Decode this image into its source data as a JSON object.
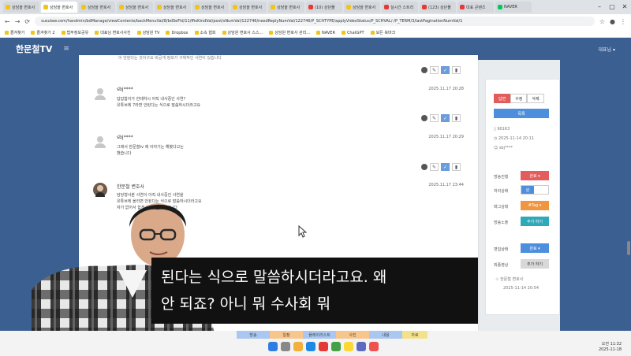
{
  "browser": {
    "tabs": [
      {
        "label": "상담을 변호사",
        "favicon": "y",
        "active": false
      },
      {
        "label": "상담을 변호사",
        "favicon": "y",
        "active": true
      },
      {
        "label": "상담을 변호사",
        "favicon": "y",
        "active": false
      },
      {
        "label": "상담을 변호사",
        "favicon": "y",
        "active": false
      },
      {
        "label": "상담을 변호사",
        "favicon": "y",
        "active": false
      },
      {
        "label": "상담을 변호사",
        "favicon": "y",
        "active": false
      },
      {
        "label": "상담을 변호사",
        "favicon": "y",
        "active": false
      },
      {
        "label": "상담을 변호사",
        "favicon": "y",
        "active": false
      },
      {
        "label": "(10) 상단물",
        "favicon": "r",
        "active": false
      },
      {
        "label": "상담을 변호사",
        "favicon": "y",
        "active": false
      },
      {
        "label": "실시간 스트리",
        "favicon": "r",
        "active": false
      },
      {
        "label": "(123) 상단물",
        "favicon": "r",
        "active": false
      },
      {
        "label": "대표 큰렌츠",
        "favicon": "r",
        "active": false
      },
      {
        "label": "NAVER",
        "favicon": "g",
        "active": false
      }
    ],
    "url": "susulaw.com/handmin/bdManage/viewContents/backMenuVal/8/bdSeFld/11/ffixKindVal/post/sNumVal/122746/needReplyNumVal/122746/P_SCHTYPE/applyVideoStatus/P_SCHVAL/-/P_TERM/3/lastPaginationNumVal/1",
    "bookmarks": [
      "즐겨찾기",
      "즐겨찾기 2",
      "법무정보공유",
      "대표님 변호사사진",
      "상담원 TV",
      "Dropbox",
      "소속 협회",
      "상담원 변호사 스스...",
      "상담원 변호사 관리...",
      "NAVER",
      "ChatGPT",
      "모든 북마크"
    ]
  },
  "app": {
    "logo": "한문철TV",
    "menu_icon": "≡",
    "user": "대표님 ▾"
  },
  "top_note": "이 안된다는 것이구요 비공개 정보가 구체적인 사연이 있습니다",
  "comments": [
    {
      "name": "sbj****",
      "date": "2025.11.17 20:28",
      "body": [
        "답답함이가 한테하시 아직 내사중인 사연?",
        "유튜브에 7라면 안된다는 식으로 말씀하시더라고요"
      ]
    },
    {
      "name": "sbj****",
      "date": "2025.11.17 20:29",
      "body": [
        "그래서 한문철tv 에 이야기는 해봤다고는",
        "했습니다"
      ]
    },
    {
      "name": "한문철 변호사",
      "date": "2025.11.17 23:44",
      "body": [
        "담당형사분 사연이 아직 내사중인 사연을",
        "유튜브에 올리면 안된다는 식으로 말씀하시더라고요",
        "",
        "",
        "",
        "자가 없어서 쉽게 해서 해야 한답니다"
      ]
    }
  ],
  "sidebar": {
    "buttons": [
      "답변",
      "수정",
      "삭제"
    ],
    "wide_button": "목록",
    "post_no": "90163",
    "post_date": "2025-11-14 20:11",
    "author": "sbj****",
    "rows": [
      {
        "label": "방송진행",
        "value": "완료 ▾",
        "style": "red"
      },
      {
        "label": "처리상태",
        "value": "완",
        "style": "toggle"
      },
      {
        "label": "태그상태",
        "value": "#Tag ▾",
        "style": "orange"
      },
      {
        "label": "방송노출",
        "value": "추가 하기",
        "style": "teal"
      },
      {
        "label": "편집상태",
        "value": "완료 ▾",
        "style": "blue"
      },
      {
        "label": "최종영상",
        "value": "추가 하기",
        "style": "gray"
      }
    ],
    "editor": "한문철 변호사",
    "editor_date": "2025-11-14 20:54"
  },
  "caption": [
    "된다는 식으로 말씀하시더라고요. 왜",
    "안 되죠? 아니 뭐 수사회 뭐"
  ],
  "taskbar": {
    "strip": [
      "방송",
      "일정",
      "플레이리스트",
      "사진",
      "내용",
      "자료"
    ],
    "time": "오전 11:32",
    "date": "2025-11-18"
  },
  "colors": {
    "header": "#3b5f91",
    "accent_blue": "#4d8fdd",
    "accent_red": "#e35d5d"
  }
}
